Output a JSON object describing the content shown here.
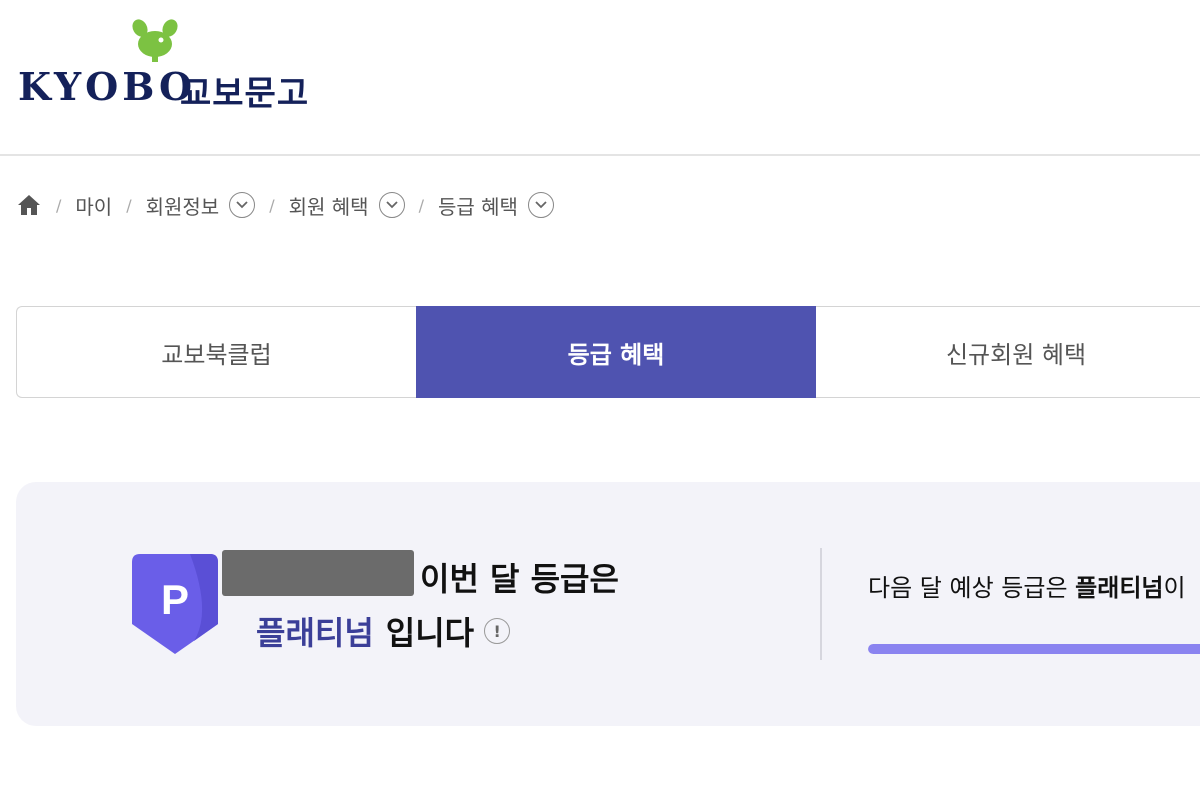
{
  "header": {
    "logo_en": "KYOBO",
    "logo_ko": "교보문고"
  },
  "breadcrumb": {
    "items": [
      "마이",
      "회원정보",
      "회원 혜택",
      "등급 혜택"
    ]
  },
  "tabs": [
    {
      "label": "교보북클럽",
      "active": false
    },
    {
      "label": "등급 혜택",
      "active": true
    },
    {
      "label": "신규회원 혜택",
      "active": false
    }
  ],
  "grade_card": {
    "badge_letter": "P",
    "line1_suffix": "이번 달 등급은",
    "grade_name": "플래티넘",
    "line2_suffix": "입니다",
    "info_symbol": "!",
    "next_prefix": "다음 달 예상 등급은 ",
    "next_grade": "플래티넘",
    "next_suffix": "이",
    "progress_percent": 100
  },
  "colors": {
    "brand_navy": "#14215a",
    "brand_green": "#7cc242",
    "accent_purple": "#4f53b0",
    "badge_purple": "#6a5ee8",
    "progress": "#8a83f0"
  }
}
